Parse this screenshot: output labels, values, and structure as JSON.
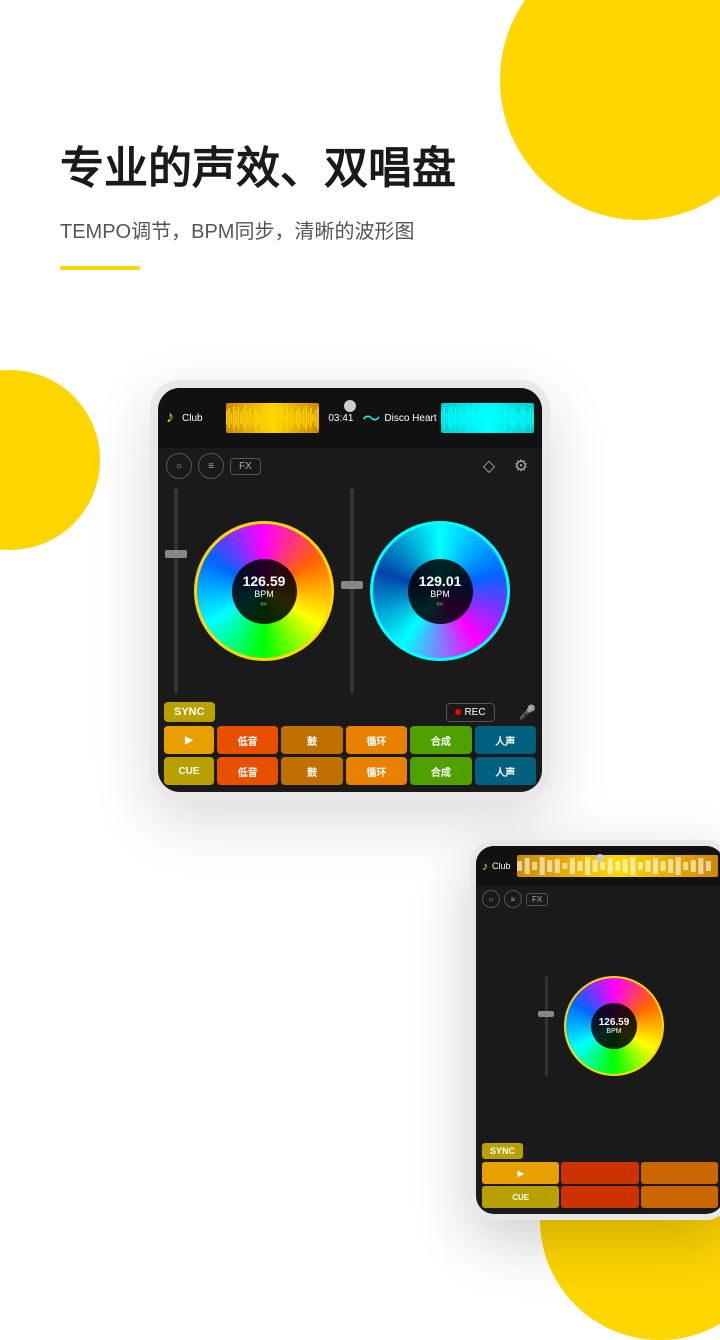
{
  "hero": {
    "title": "专业的声效、双唱盘",
    "subtitle": "TEMPO调节，BPM同步，清晰的波形图"
  },
  "dj_interface": {
    "track1_label": "Club",
    "track2_label": "Disco Heart",
    "time": "03:41",
    "bpm1": "126.59",
    "bpm2": "129.01",
    "bpm_unit": "BPM",
    "sync_label": "SYNC",
    "rec_label": "REC",
    "fx_label": "FX",
    "pads_row1": [
      "▶",
      "低音",
      "鼓",
      "循环",
      "合成",
      "人声"
    ],
    "pads_row2": [
      "CUE",
      "低音",
      "鼓",
      "循环",
      "合成",
      "人声"
    ]
  },
  "phone2": {
    "track_label": "Club",
    "sync_label": "SYNC",
    "cue_label": "CUE",
    "fx_label": "FX"
  },
  "colors": {
    "yellow": "#FFD600",
    "cyan": "#00ffff",
    "dark_bg": "#1a1a1a"
  }
}
